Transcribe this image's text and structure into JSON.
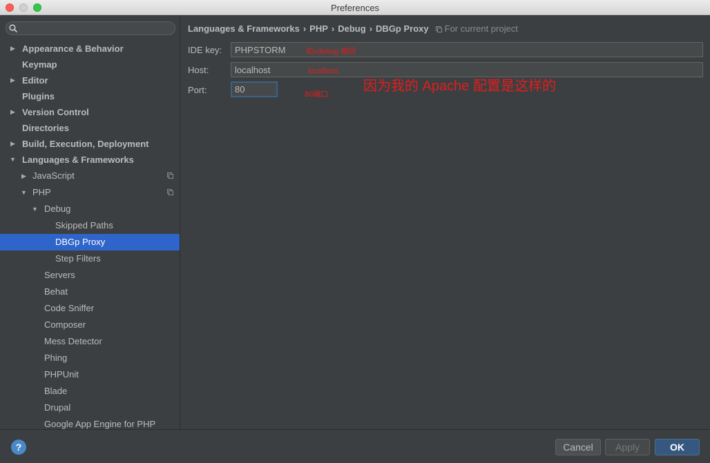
{
  "window": {
    "title": "Preferences"
  },
  "search": {
    "placeholder": ""
  },
  "sidebar": {
    "items": [
      {
        "label": "Appearance & Behavior",
        "expander": "collapsed"
      },
      {
        "label": "Keymap"
      },
      {
        "label": "Editor",
        "expander": "collapsed"
      },
      {
        "label": "Plugins"
      },
      {
        "label": "Version Control",
        "expander": "collapsed"
      },
      {
        "label": "Directories"
      },
      {
        "label": "Build, Execution, Deployment",
        "expander": "collapsed"
      },
      {
        "label": "Languages & Frameworks",
        "expander": "expanded"
      },
      {
        "label": "JavaScript",
        "expander": "collapsed",
        "project_icon": true
      },
      {
        "label": "PHP",
        "expander": "expanded",
        "project_icon": true
      },
      {
        "label": "Debug",
        "expander": "expanded"
      },
      {
        "label": "Skipped Paths"
      },
      {
        "label": "DBGp Proxy",
        "selected": true
      },
      {
        "label": "Step Filters"
      },
      {
        "label": "Servers"
      },
      {
        "label": "Behat"
      },
      {
        "label": "Code Sniffer"
      },
      {
        "label": "Composer"
      },
      {
        "label": "Mess Detector"
      },
      {
        "label": "Phing"
      },
      {
        "label": "PHPUnit"
      },
      {
        "label": "Blade"
      },
      {
        "label": "Drupal"
      },
      {
        "label": "Google App Engine for PHP"
      }
    ]
  },
  "breadcrumb": {
    "parts": [
      "Languages & Frameworks",
      "PHP",
      "Debug",
      "DBGp Proxy"
    ],
    "separator": "›",
    "scope": "For current project"
  },
  "form": {
    "ide_key": {
      "label": "IDE key:",
      "value": "PHPSTORM"
    },
    "host": {
      "label": "Host:",
      "value": "localhost"
    },
    "port": {
      "label": "Port:",
      "value": "80"
    }
  },
  "annotations": {
    "ide_key_note": "和xdebug 相同",
    "host_note": "localhost",
    "port_note": "80端口",
    "main_note": "因为我的 Apache 配置是这样的"
  },
  "buttons": {
    "help": "?",
    "cancel": "Cancel",
    "apply": "Apply",
    "ok": "OK"
  },
  "colors": {
    "selection": "#2f65ca",
    "annotation": "#e01e1e",
    "ok_button": "#365880"
  }
}
